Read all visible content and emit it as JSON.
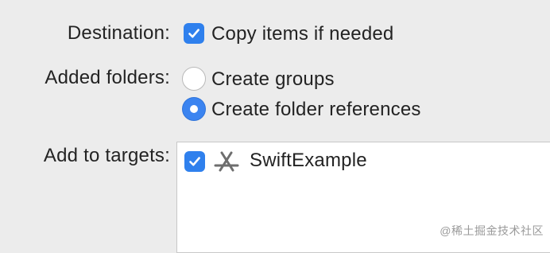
{
  "destination": {
    "label": "Destination:",
    "option_label": "Copy items if needed",
    "checked": true
  },
  "added_folders": {
    "label": "Added folders:",
    "options": [
      {
        "label": "Create groups",
        "selected": false
      },
      {
        "label": "Create folder references",
        "selected": true
      }
    ]
  },
  "add_to_targets": {
    "label": "Add to targets:",
    "targets": [
      {
        "name": "SwiftExample",
        "checked": true,
        "icon": "app-target-icon"
      }
    ]
  },
  "watermark": "@稀土掘金技术社区",
  "colors": {
    "background": "#ececec",
    "accent": "#2f80ed",
    "text": "#232323"
  }
}
